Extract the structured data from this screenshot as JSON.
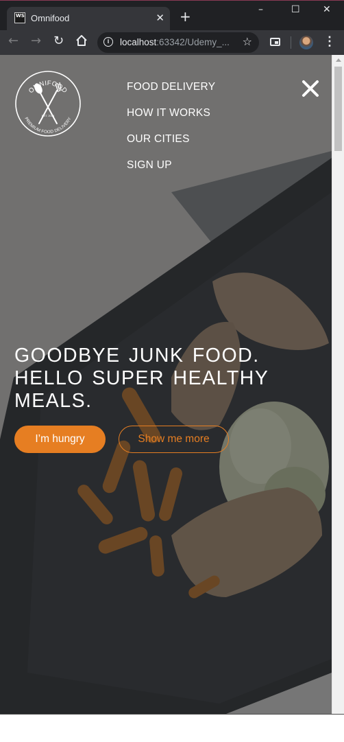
{
  "browser": {
    "tab_title": "Omnifood",
    "tab_icon_text": "WS",
    "tab_close_glyph": "✕",
    "new_tab_glyph": "+",
    "url_host": "localhost",
    "url_rest": ":63342/Udemy_...",
    "window_controls": {
      "minimize": "–",
      "maximize": "☐",
      "close": "✕"
    }
  },
  "site": {
    "logo": {
      "brand": "OMNIFOOD",
      "tagline": "PREMIUM FOOD DELIVERY",
      "est": "EST. 2014"
    },
    "nav": [
      {
        "label": "FOOD DELIVERY"
      },
      {
        "label": "HOW IT WORKS"
      },
      {
        "label": "OUR CITIES"
      },
      {
        "label": "SIGN UP"
      }
    ],
    "hero": {
      "title_lines": [
        "GOODBYE JUNK FOOD.",
        "HELLO SUPER HEALTHY",
        "MEALS."
      ],
      "primary_button": "I’m hungry",
      "secondary_button": "Show me more"
    }
  },
  "colors": {
    "accent": "#e67e22",
    "chrome_dark": "#202124",
    "chrome_toolbar": "#35363a"
  },
  "icons": [
    "webstorm-icon",
    "close-tab-icon",
    "new-tab-icon",
    "back-icon",
    "forward-icon",
    "reload-icon",
    "home-icon",
    "info-icon",
    "bookmark-star-icon",
    "picture-in-picture-icon",
    "profile-avatar",
    "menu-dots-icon",
    "close-menu-icon"
  ]
}
